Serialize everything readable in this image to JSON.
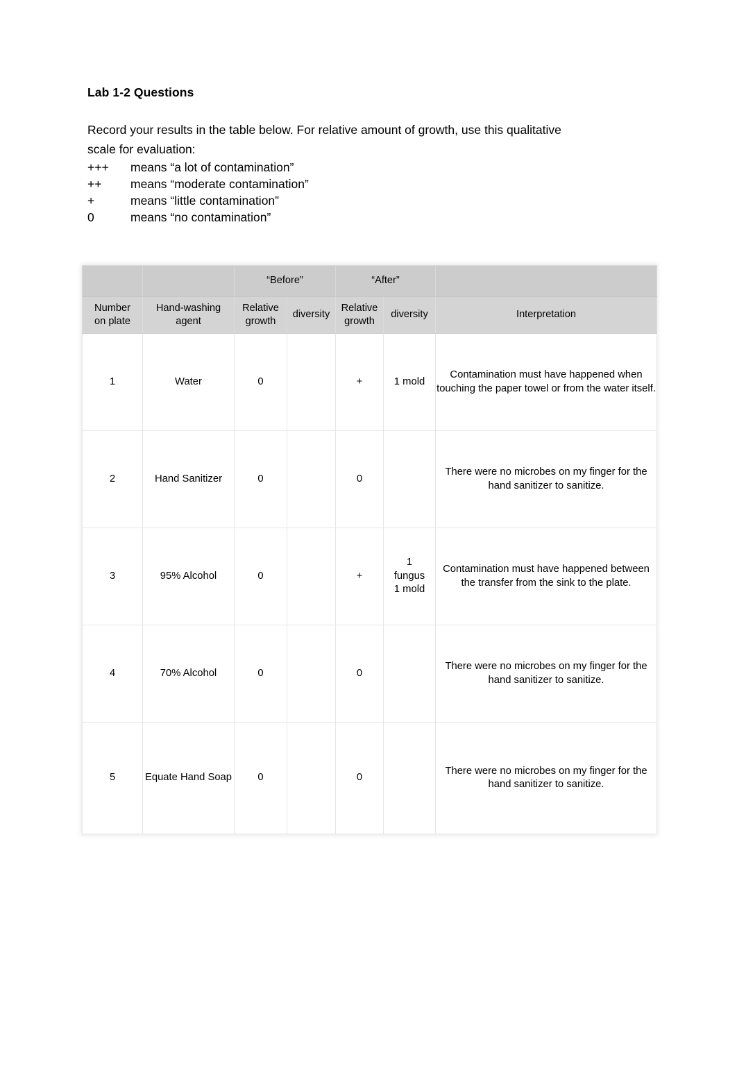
{
  "document": {
    "title": "Lab 1-2 Questions",
    "intro": "Record your results in the table below. For relative amount of growth, use this qualitative scale for evaluation:",
    "scale": [
      {
        "symbol": "+++",
        "meaning": "means “a lot of contamination”"
      },
      {
        "symbol": "++",
        "meaning": "means “moderate contamination”"
      },
      {
        "symbol": "+",
        "meaning": "means “little contamination”"
      },
      {
        "symbol": "0",
        "meaning": "means “no contamination”"
      }
    ]
  },
  "table": {
    "group_headers": {
      "before": "“Before”",
      "after": "“After”"
    },
    "columns": [
      {
        "key": "plate",
        "label_line1": "Number",
        "label_line2": "on plate"
      },
      {
        "key": "agent",
        "label_line1": "Hand-washing",
        "label_line2": "agent"
      },
      {
        "key": "before_growth",
        "label_line1": "Relative",
        "label_line2": "growth"
      },
      {
        "key": "before_diversity",
        "label_line1": "diversity",
        "label_line2": ""
      },
      {
        "key": "after_growth",
        "label_line1": "Relative",
        "label_line2": "growth"
      },
      {
        "key": "after_diversity",
        "label_line1": "diversity",
        "label_line2": ""
      },
      {
        "key": "interpretation",
        "label_line1": "Interpretation",
        "label_line2": ""
      }
    ],
    "rows": [
      {
        "plate": "1",
        "agent": "Water",
        "before_growth": "0",
        "before_diversity": "",
        "after_growth": "+",
        "after_diversity": "1 mold",
        "interpretation": "Contamination must have happened when touching the paper towel or from the water itself."
      },
      {
        "plate": "2",
        "agent": "Hand Sanitizer",
        "before_growth": "0",
        "before_diversity": "",
        "after_growth": "0",
        "after_diversity": "",
        "interpretation": "There were no microbes on my finger for the hand sanitizer to sanitize."
      },
      {
        "plate": "3",
        "agent": "95% Alcohol",
        "before_growth": "0",
        "before_diversity": "",
        "after_growth": "+",
        "after_diversity": "1\nfungus\n1 mold",
        "interpretation": "Contamination must have happened between the transfer from the sink to the plate."
      },
      {
        "plate": "4",
        "agent": "70% Alcohol",
        "before_growth": "0",
        "before_diversity": "",
        "after_growth": "0",
        "after_diversity": "",
        "interpretation": "There were no microbes on my finger for the hand sanitizer to sanitize."
      },
      {
        "plate": "5",
        "agent": "Equate Hand Soap",
        "before_growth": "0",
        "before_diversity": "",
        "after_growth": "0",
        "after_diversity": "",
        "interpretation": "There were no microbes on my finger for the hand sanitizer to sanitize."
      }
    ]
  },
  "colors": {
    "page_background": "#ffffff",
    "header_band_top": "#cccccc",
    "header_band_main": "#d4d4d4",
    "cell_border": "#e6e6e6",
    "text": "#000000"
  }
}
